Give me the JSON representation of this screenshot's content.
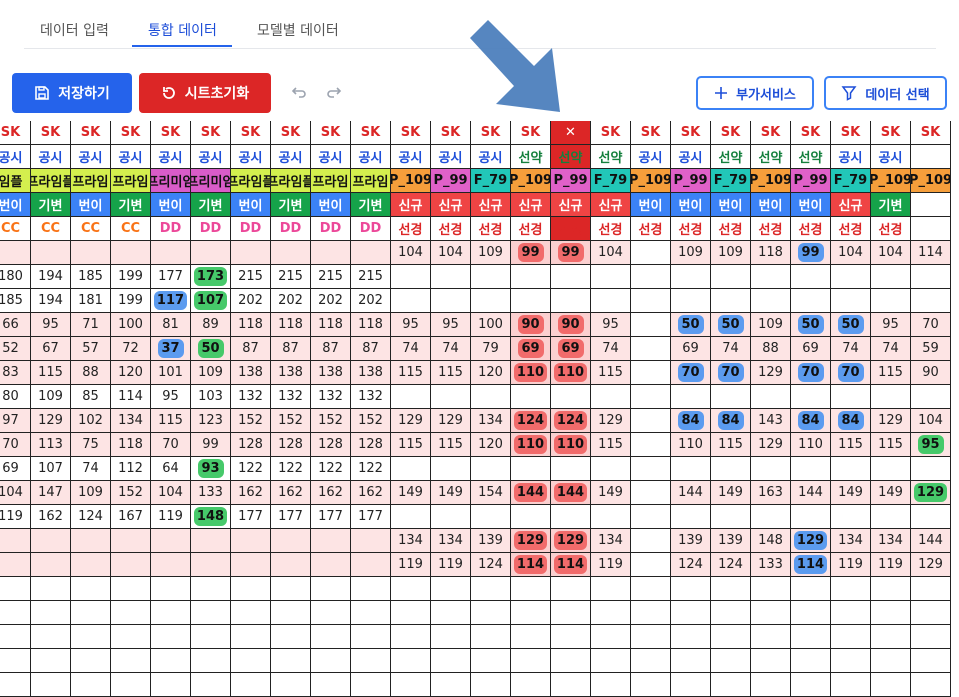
{
  "tabs": [
    {
      "label": "데이터 입력"
    },
    {
      "label": "통합 데이터"
    },
    {
      "label": "모델별 데이터"
    }
  ],
  "toolbar": {
    "save_label": "저장하기",
    "reset_label": "시트초기화",
    "extra_label": "부가서비스",
    "data_select_label": "데이터 선택"
  },
  "colors": {
    "primary": "#2563eb",
    "danger": "#dc2626",
    "header_red_text": "#dc2626",
    "header_blue_text": "#1d4ed8",
    "header_green_text": "#15803d",
    "cc_orange": "#f97316",
    "dd_pink": "#ec4899",
    "row_pink": "#fde4e4",
    "row_pink_strong": "#fbd0d0",
    "cell_selected": "#f8c5c5"
  },
  "table": {
    "header_carrier": [
      "SK",
      "SK",
      "SK",
      "SK",
      "SK",
      "SK",
      "SK",
      "SK",
      "SK",
      "SK",
      "SK",
      "SK",
      "SK",
      "SK",
      "",
      "SK",
      "SK",
      "SK",
      "SK",
      "SK",
      "SK",
      "SK",
      "SK",
      "SK"
    ],
    "header_type": [
      "공시",
      "공시",
      "공시",
      "공시",
      "공시",
      "공시",
      "공시",
      "공시",
      "공시",
      "공시",
      "공시",
      "공시",
      "공시",
      "선약",
      "선약",
      "선약",
      "공시",
      "공시",
      "선약",
      "선약",
      "선약",
      "공시",
      "공시"
    ],
    "header_plan": [
      "임플",
      "프라임플",
      "프라임",
      "프라임",
      "프리미엄",
      "프리미엄",
      "프라임플",
      "프라임플",
      "프라임",
      "프라임",
      "P_109",
      "P_99",
      "F_79",
      "P_109",
      "P_99",
      "F_79",
      "P_109",
      "P_99",
      "F_79",
      "P_109",
      "P_99",
      "F_79",
      "P_109",
      "P_109"
    ],
    "header_plan_colors": [
      "#d4ef4e",
      "#d4ef4e",
      "#d4ef4e",
      "#d4ef4e",
      "#d95cc9",
      "#d95cc9",
      "#d4ef4e",
      "#d4ef4e",
      "#d4ef4e",
      "#d4ef4e",
      "#f59e3b",
      "#e061c8",
      "#22c7b8",
      "#f59e3b",
      "#e061c8",
      "#22c7b8",
      "#f59e3b",
      "#e061c8",
      "#22c7b8",
      "#f59e3b",
      "#e061c8",
      "#22c7b8",
      "#f59e3b",
      "#f59e3b"
    ],
    "header_kind": [
      "번이",
      "기변",
      "번이",
      "기변",
      "번이",
      "기변",
      "번이",
      "기변",
      "번이",
      "기변",
      "신규",
      "신규",
      "신규",
      "신규",
      "신규",
      "신규",
      "번이",
      "번이",
      "번이",
      "번이",
      "번이",
      "신규",
      "기변"
    ],
    "header_kind_colors": [
      "#3b82f6",
      "#16a34a",
      "#3b82f6",
      "#16a34a",
      "#3b82f6",
      "#16a34a",
      "#3b82f6",
      "#16a34a",
      "#3b82f6",
      "#16a34a",
      "#ef4444",
      "#ef4444",
      "#ef4444",
      "#ef4444",
      "#ef4444",
      "#ef4444",
      "#3b82f6",
      "#3b82f6",
      "#3b82f6",
      "#3b82f6",
      "#3b82f6",
      "#ef4444",
      "#16a34a"
    ],
    "header_grade": [
      "CC",
      "CC",
      "CC",
      "CC",
      "DD",
      "DD",
      "DD",
      "DD",
      "DD",
      "DD",
      "선경",
      "선경",
      "선경",
      "선경",
      "선경",
      "선경",
      "선경",
      "선경",
      "선경",
      "선경",
      "선경",
      "선경",
      "선경"
    ],
    "rows": [
      [
        "",
        "",
        "",
        "",
        "",
        "",
        "",
        "",
        "",
        "",
        "104",
        "104",
        "109",
        "!r99",
        "!r99",
        "104",
        "",
        "109",
        "109",
        "118",
        "!b99",
        "104",
        "104",
        "114"
      ],
      [
        "180",
        "194",
        "185",
        "199",
        "177",
        "!g173",
        "215",
        "215",
        "215",
        "215",
        "",
        "",
        "",
        "",
        "",
        "",
        "",
        "",
        "",
        "",
        "",
        "",
        "",
        ""
      ],
      [
        "185",
        "194",
        "181",
        "199",
        "!b117",
        "!g107",
        "202",
        "202",
        "202",
        "202",
        "",
        "",
        "",
        "",
        "",
        "",
        "",
        "",
        "",
        "",
        "",
        "",
        "",
        ""
      ],
      [
        "66",
        "95",
        "71",
        "100",
        "81",
        "89",
        "118",
        "118",
        "118",
        "118",
        "95",
        "95",
        "100",
        "!r90",
        "!r90",
        "95",
        "",
        "!b50",
        "!b50",
        "109",
        "!b50",
        "!b50",
        "95",
        "70"
      ],
      [
        "52",
        "67",
        "57",
        "72",
        "!b37",
        "!g50",
        "87",
        "87",
        "87",
        "87",
        "74",
        "74",
        "79",
        "!r69",
        "!r69",
        "74",
        "",
        "69",
        "74",
        "88",
        "69",
        "74",
        "74",
        "59"
      ],
      [
        "83",
        "115",
        "88",
        "120",
        "101",
        "109",
        "138",
        "138",
        "138",
        "138",
        "115",
        "115",
        "120",
        "!r110",
        "!r110",
        "115",
        "",
        "!b70",
        "!b70",
        "129",
        "!b70",
        "!b70",
        "115",
        "90"
      ],
      [
        "80",
        "109",
        "85",
        "114",
        "95",
        "103",
        "132",
        "132",
        "132",
        "132",
        "",
        "",
        "",
        "",
        "",
        "",
        "",
        "",
        "",
        "",
        "",
        "",
        "",
        ""
      ],
      [
        "97",
        "129",
        "102",
        "134",
        "115",
        "123",
        "152",
        "152",
        "152",
        "152",
        "129",
        "129",
        "134",
        "!r124",
        "!r124",
        "129",
        "",
        "!b84",
        "!b84",
        "143",
        "!b84",
        "!b84",
        "129",
        "104"
      ],
      [
        "70",
        "113",
        "75",
        "118",
        "70",
        "99",
        "128",
        "128",
        "128",
        "128",
        "115",
        "115",
        "120",
        "!r110",
        "!r110",
        "115",
        "",
        "110",
        "115",
        "129",
        "110",
        "115",
        "115",
        "!g95"
      ],
      [
        "69",
        "107",
        "74",
        "112",
        "64",
        "!g93",
        "122",
        "122",
        "122",
        "122",
        "",
        "",
        "",
        "",
        "",
        "",
        "",
        "",
        "",
        "",
        "",
        "",
        "",
        ""
      ],
      [
        "104",
        "147",
        "109",
        "152",
        "104",
        "133",
        "162",
        "162",
        "162",
        "162",
        "149",
        "149",
        "154",
        "!r144",
        "!r144",
        "149",
        "",
        "144",
        "149",
        "163",
        "144",
        "149",
        "149",
        "!g129"
      ],
      [
        "119",
        "162",
        "124",
        "167",
        "119",
        "!g148",
        "177",
        "177",
        "177",
        "177",
        "",
        "",
        "",
        "",
        "",
        "",
        "",
        "",
        "",
        "",
        "",
        "",
        "",
        ""
      ],
      [
        "",
        "",
        "",
        "",
        "",
        "",
        "",
        "",
        "",
        "",
        "134",
        "134",
        "139",
        "!r129",
        "!r129",
        "134",
        "",
        "139",
        "139",
        "148",
        "!b129",
        "134",
        "134",
        "144"
      ],
      [
        "",
        "",
        "",
        "",
        "",
        "",
        "",
        "",
        "",
        "",
        "119",
        "119",
        "124",
        "!r114",
        "!r114",
        "119",
        "",
        "124",
        "124",
        "133",
        "!b114",
        "119",
        "119",
        "129"
      ],
      [
        "",
        "",
        "",
        "",
        "",
        "",
        "",
        "",
        "",
        "",
        "",
        "",
        "",
        "",
        "",
        "",
        "",
        "",
        "",
        "",
        "",
        "",
        "",
        ""
      ],
      [
        "",
        "",
        "",
        "",
        "",
        "",
        "",
        "",
        "",
        "",
        "",
        "",
        "",
        "",
        "",
        "",
        "",
        "",
        "",
        "",
        "",
        "",
        "",
        ""
      ],
      [
        "",
        "",
        "",
        "",
        "",
        "",
        "",
        "",
        "",
        "",
        "",
        "",
        "",
        "",
        "",
        "",
        "",
        "",
        "",
        "",
        "",
        "",
        "",
        ""
      ],
      [
        "",
        "",
        "",
        "",
        "",
        "",
        "",
        "",
        "",
        "",
        "",
        "",
        "",
        "",
        "",
        "",
        "",
        "",
        "",
        "",
        "",
        "",
        "",
        ""
      ],
      [
        "",
        "",
        "",
        "",
        "",
        "",
        "",
        "",
        "",
        "",
        "",
        "",
        "",
        "",
        "",
        "",
        "",
        "",
        "",
        "",
        "",
        "",
        "",
        ""
      ]
    ],
    "row_shading": [
      "pink",
      "none",
      "none",
      "pink",
      "pink",
      "pink",
      "none",
      "pink",
      "pink",
      "none",
      "pink",
      "none",
      "pink",
      "pink",
      "none",
      "none",
      "none",
      "none",
      "none"
    ]
  }
}
